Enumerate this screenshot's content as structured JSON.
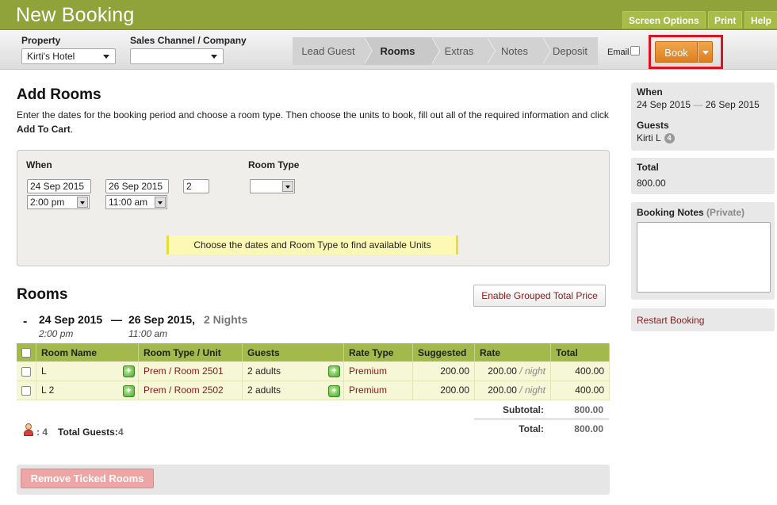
{
  "header": {
    "title": "New Booking",
    "buttons": [
      "Screen Options",
      "Print",
      "Help"
    ]
  },
  "subbar": {
    "property_label": "Property",
    "property_value": "Kirti's Hotel",
    "channel_label": "Sales Channel / Company",
    "channel_value": "",
    "steps": [
      "Lead Guest",
      "Rooms",
      "Extras",
      "Notes",
      "Deposit"
    ],
    "active_step": "Rooms",
    "email_label": "Email",
    "book_label": "Book"
  },
  "add_rooms": {
    "title": "Add Rooms",
    "intro_text": "Enter the dates for the booking period and choose a room type. Then choose the units to book, fill out all of the required information and click ",
    "intro_bold": "Add To Cart",
    "intro_end": ".",
    "when_label": "When",
    "start_date": "24 Sep 2015",
    "start_time": "2:00 pm",
    "end_date": "26 Sep 2015",
    "end_time": "11:00 am",
    "nights": "2",
    "room_type_label": "Room Type",
    "room_type_value": "",
    "hint": "Choose the dates and Room Type to find available Units"
  },
  "rooms": {
    "title": "Rooms",
    "grouped_button": "Enable Grouped Total Price",
    "dash": "-",
    "range_start": "24 Sep 2015",
    "range_sep": "—",
    "range_end": "26 Sep 2015,",
    "range_nights": "2 Nights",
    "range_start_time": "2:00 pm",
    "range_end_time": "11:00 am",
    "columns": [
      "Room Name",
      "Room Type / Unit",
      "Guests",
      "Rate Type",
      "Suggested",
      "Rate",
      "Total"
    ],
    "rows": [
      {
        "name": "L",
        "unit": "Prem / Room 2501",
        "guests": "2 adults",
        "rate_type": "Premium",
        "suggested": "200.00",
        "rate": "200.00",
        "rate_unit": "/ night",
        "total": "400.00"
      },
      {
        "name": "L 2",
        "unit": "Prem / Room 2502",
        "guests": "2 adults",
        "rate_type": "Premium",
        "suggested": "200.00",
        "rate": "200.00",
        "rate_unit": "/ night",
        "total": "400.00"
      }
    ],
    "subtotal_label": "Subtotal:",
    "subtotal_value": "800.00",
    "total_label": "Total:",
    "total_value": "800.00",
    "guest_icon_count": ": 4",
    "total_guests_label": "Total Guests:",
    "total_guests_value": "4",
    "remove_button": "Remove Ticked Rooms"
  },
  "sidebar": {
    "when_label": "When",
    "when_start": "24 Sep 2015",
    "when_sep": "—",
    "when_end": "26 Sep 2015",
    "guests_label": "Guests",
    "guest_name": "Kirti L",
    "guest_count": "4",
    "total_label": "Total",
    "total_value": "800.00",
    "notes_label": "Booking Notes",
    "notes_private": "(Private)",
    "restart": "Restart Booking"
  },
  "colors": {
    "brand_green": "#8fa33a",
    "table_header": "#a4b94b",
    "book_orange": "#e8902f",
    "highlight_red": "#e0111f",
    "link_red": "#8b1a1a"
  }
}
